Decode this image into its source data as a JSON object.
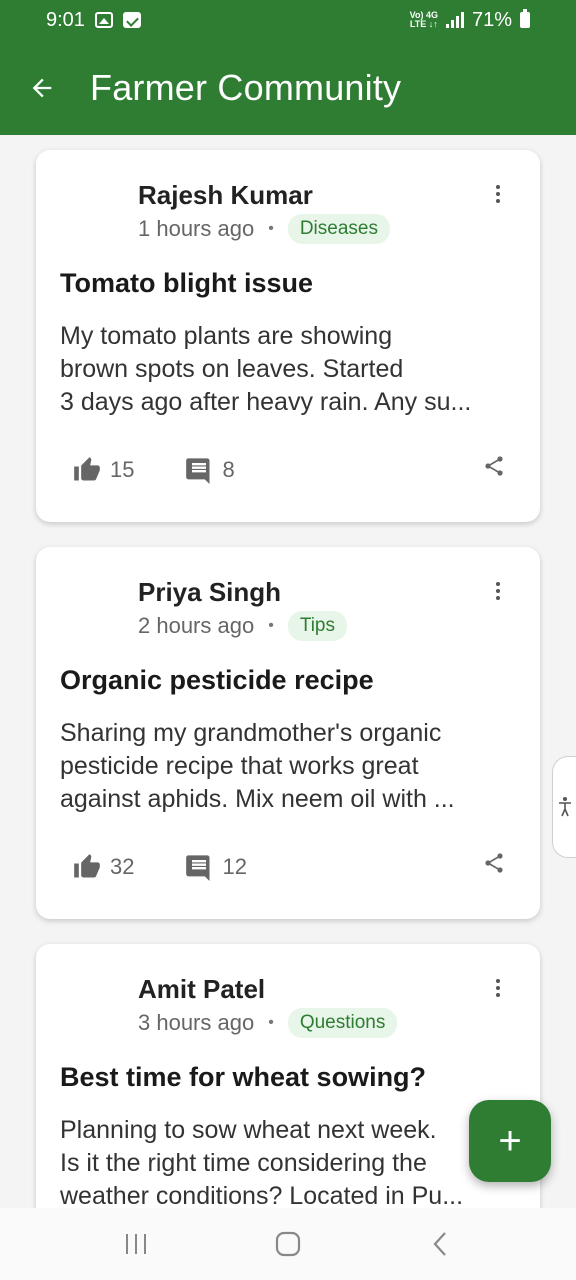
{
  "status": {
    "time": "9:01",
    "network_top": "Vo) 4G",
    "network_bottom": "LTE ↓↑",
    "battery": "71%"
  },
  "app_bar": {
    "title": "Farmer Community"
  },
  "posts": [
    {
      "author": "Rajesh Kumar",
      "time": "1 hours ago",
      "tag": "Diseases",
      "title": "Tomato blight issue",
      "body_lines": [
        "My tomato plants are showing",
        "brown spots on leaves. Started",
        "3 days ago after heavy rain. Any su..."
      ],
      "likes": "15",
      "comments": "8"
    },
    {
      "author": "Priya Singh",
      "time": "2 hours ago",
      "tag": "Tips",
      "title": "Organic pesticide recipe",
      "body_lines": [
        "Sharing my grandmother's organic",
        "pesticide recipe that works great",
        "against aphids. Mix neem oil with ..."
      ],
      "likes": "32",
      "comments": "12"
    },
    {
      "author": "Amit Patel",
      "time": "3 hours ago",
      "tag": "Questions",
      "title": "Best time for wheat sowing?",
      "body_lines": [
        "Planning to sow wheat next week.",
        "Is it the right time considering the",
        "weather conditions? Located in Pu..."
      ],
      "likes": "",
      "comments": ""
    }
  ],
  "fab": {
    "label": "+"
  },
  "colors": {
    "primary": "#2e7d32",
    "tag_bg": "#e8f5e9"
  }
}
